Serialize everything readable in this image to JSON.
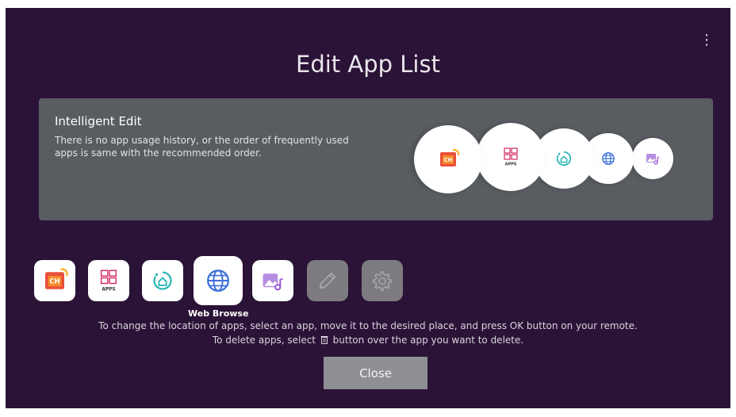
{
  "header": {
    "title": "Edit App List",
    "more_menu": "⋮"
  },
  "intelligent_edit": {
    "title": "Intelligent Edit",
    "description": "There is no app usage history, or the order of frequently used apps is same with the recommended order.",
    "preview_icons": [
      "ch-icon",
      "apps-icon",
      "home-dashboard-icon",
      "globe-icon",
      "media-icon"
    ]
  },
  "app_list": {
    "items": [
      {
        "name": "ch",
        "icon": "ch-icon",
        "label": "CH"
      },
      {
        "name": "apps",
        "icon": "apps-icon",
        "label": "APPS"
      },
      {
        "name": "home-dashboard",
        "icon": "home-dashboard-icon"
      },
      {
        "name": "web-browser",
        "icon": "globe-icon",
        "label": "Web Browse",
        "focused": true
      },
      {
        "name": "media",
        "icon": "media-icon"
      },
      {
        "name": "edit",
        "icon": "pencil-icon"
      },
      {
        "name": "settings",
        "icon": "gear-icon"
      }
    ],
    "focused_label": "Web Browse"
  },
  "instructions": {
    "line1": "To change the location of apps, select an app, move it to the desired place, and press OK button on your remote.",
    "line2_before": "To delete apps, select",
    "line2_icon": "trash-icon",
    "line2_after": "button over the app you want to delete."
  },
  "close_button": {
    "label": "Close"
  },
  "colors": {
    "background": "#2b1337",
    "panel": "#595d62",
    "button": "#8f8e95",
    "apps_pink": "#d6336c",
    "teal": "#1fb3b3",
    "blue": "#3b6fd8",
    "purple": "#9b59d6"
  }
}
